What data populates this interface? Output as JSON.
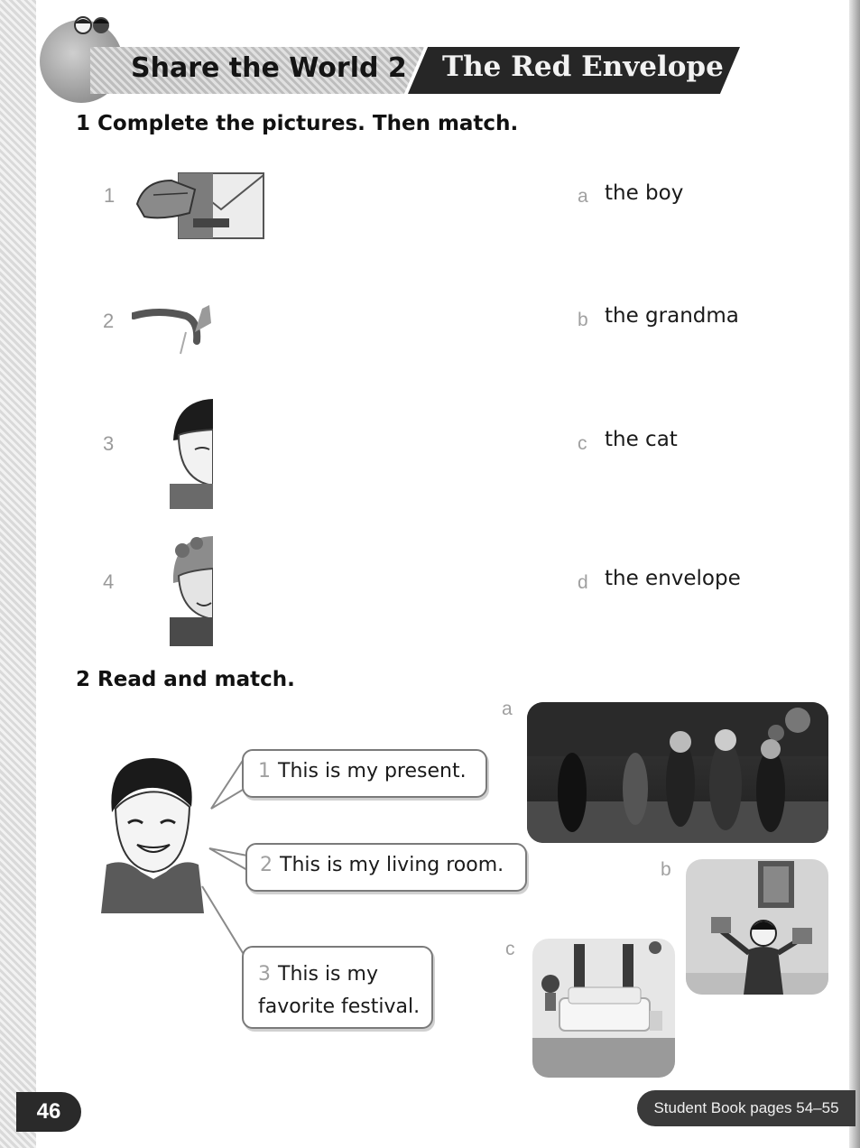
{
  "header": {
    "section": "Share the World 2",
    "title": "The Red Envelope"
  },
  "exercise1": {
    "heading": "1  Complete the pictures. Then match.",
    "items": [
      {
        "num": "1",
        "picture": "envelope-hand-picture"
      },
      {
        "num": "2",
        "picture": "cat-tail-picture"
      },
      {
        "num": "3",
        "picture": "boy-half-face-picture"
      },
      {
        "num": "4",
        "picture": "grandma-half-face-picture"
      }
    ],
    "answers": [
      {
        "letter": "a",
        "text": "the boy"
      },
      {
        "letter": "b",
        "text": "the grandma"
      },
      {
        "letter": "c",
        "text": "the cat"
      },
      {
        "letter": "d",
        "text": "the envelope"
      }
    ]
  },
  "exercise2": {
    "heading": "2  Read and match.",
    "bubbles": [
      {
        "num": "1",
        "text": "This is my present."
      },
      {
        "num": "2",
        "text": "This is my living room."
      },
      {
        "num": "3",
        "line1": "This is my",
        "line2": "favorite festival."
      }
    ],
    "photo_letters": {
      "a": "a",
      "b": "b",
      "c": "c"
    }
  },
  "footer": {
    "page_number": "46",
    "reference": "Student Book pages 54–55"
  }
}
